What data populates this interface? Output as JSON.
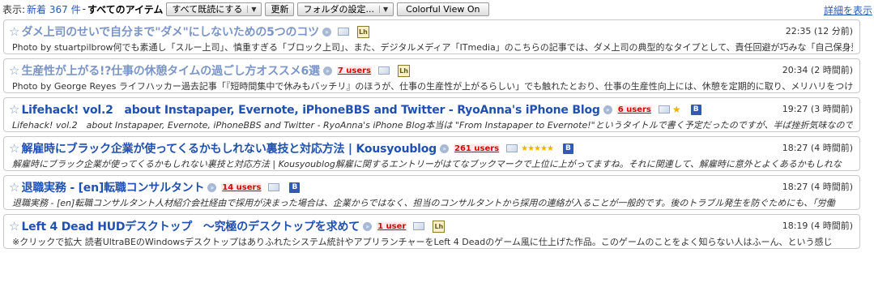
{
  "toolbar": {
    "display_label": "表示:",
    "unread_label": "新着 367 件",
    "separator": "-",
    "folder": "すべてのアイテム",
    "mark_all_read": "すべて既読にする",
    "refresh": "更新",
    "folder_settings": "フォルダの設定...",
    "colorful_view": "Colorful View On",
    "details_link": "詳細を表示"
  },
  "entries": [
    {
      "title": "ダメ上司のせいで自分まで\"ダメ\"にしないための5つのコツ",
      "users": "",
      "time": "22:35 (12 分前)",
      "desc": "Photo by stuartpilbrow何でも素通し「スルー上司」、慎重すぎる「ブロック上司」、また、デジタルメディア「ITmedia」のこちらの記事では、ダメ上司の典型的なタイプとして、責任回避が巧みな「自己保身型」",
      "read": true
    },
    {
      "title": "生産性が上がる!?仕事の休憩タイムの過ごし方オススメ6選",
      "users": "7 users",
      "time": "20:34 (2 時間前)",
      "desc": "Photo by George Reyes ライフハッカー過去記事「『短時間集中で休みもバッチリ』のほうが、仕事の生産性が上がるらしい」でも触れたとおり、仕事の生産性向上には、休憩を定期的に取り、メリハリをつけ",
      "read": true
    },
    {
      "title": "Lifehack! vol.2　about Instapaper, Evernote, iPhoneBBS and Twitter - RyoAnna's iPhone Blog",
      "users": "6 users",
      "time": "19:27 (3 時間前)",
      "desc": "Lifehack! vol.2　about Instapaper, Evernote, iPhoneBBS and Twitter - RyoAnna's iPhone Blog本当は \"From Instapaper to Evernote!\"というタイトルで書く予定だったのですが、半ば挫折気味なので",
      "read": false
    },
    {
      "title": "解雇時にブラック企業が使ってくるかもしれない裏技と対応方法 | Kousyoublog",
      "users": "261 users",
      "time": "18:27 (4 時間前)",
      "desc": "解雇時にブラック企業が使ってくるかもしれない裏技と対応方法 | Kousyoublog解雇に関するエントリーがはてなブックマークで上位に上がってますね。それに関連して、解雇時に意外とよくあるかもしれな",
      "read": false
    },
    {
      "title": "退職実務 - [en]転職コンサルタント",
      "users": "14 users",
      "time": "18:27 (4 時間前)",
      "desc": "退職実務 - [en]転職コンサルタント人材紹介会社経由で採用が決まった場合は、企業からではなく、担当のコンサルタントから採用の連絡が入ることが一般的です。後のトラブル発生を防ぐためにも、「労働",
      "read": false
    },
    {
      "title": "Left 4 Dead HUDデスクトップ　〜究極のデスクトップを求めて",
      "users": "1 user",
      "time": "18:19 (4 時間前)",
      "desc": "※クリックで拡大 読者UltraBEのWindowsデスクトップはありふれたシステム統計やアプリランチャーをLeft 4 Deadのゲーム風に仕上げた作品。このゲームのことをよく知らない人はふーん、という感じ",
      "read": false
    }
  ]
}
